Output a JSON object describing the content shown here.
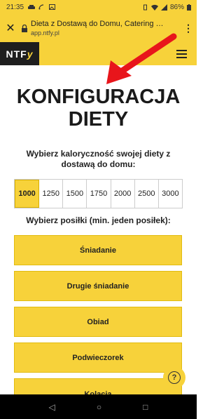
{
  "status": {
    "time": "21:35",
    "battery": "86%"
  },
  "browser": {
    "title": "Dieta z Dostawą do Domu, Catering Di...",
    "url": "app.ntfy.pl"
  },
  "site": {
    "logo_main": "NTF",
    "logo_accent": "y"
  },
  "page": {
    "title_line1": "KONFIGURACJA",
    "title_line2": "DIETY",
    "calorie_label_line1": "Wybierz kaloryczność swojej diety z",
    "calorie_label_line2": "dostawą do domu:",
    "calories": [
      "1000",
      "1250",
      "1500",
      "1750",
      "2000",
      "2500",
      "3000"
    ],
    "selected_calorie": "1000",
    "meals_label": "Wybierz posiłki (min. jeden posiłek):",
    "meals": [
      "Śniadanie",
      "Drugie śniadanie",
      "Obiad",
      "Podwieczorek",
      "Kolacja"
    ]
  },
  "help": {
    "glyph": "?"
  },
  "navbar": {
    "back": "◁",
    "home": "○",
    "recent": "□"
  },
  "colors": {
    "accent": "#f7d23a",
    "arrow": "#e8151b"
  }
}
